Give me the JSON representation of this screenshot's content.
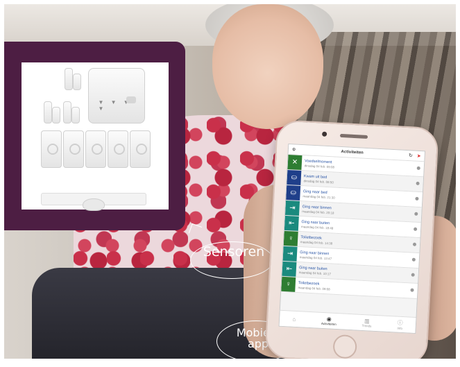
{
  "labels": {
    "sensors": "Sensoren",
    "app_line1": "Mobiele",
    "app_line2": "app"
  },
  "sensor_kit": {
    "hub_label": "▼ ▼ ▼ ▼"
  },
  "app": {
    "title": "Activiteiten",
    "icons": {
      "settings": "gear-icon",
      "refresh": "refresh-icon",
      "send": "paper-plane-icon"
    },
    "accent_green": "#2e7d32",
    "accent_blue": "#1f3f8a",
    "accent_teal": "#1b8a7e",
    "feed": [
      {
        "icon": "fork-knife-icon",
        "glyph": "✕",
        "color": "#2e7d32",
        "title": "Voedselmoment",
        "sub": "dinsdag 04 feb. 09:08"
      },
      {
        "icon": "bed-icon",
        "glyph": "⛀",
        "color": "#1f3f8a",
        "title": "Kwam uit bed",
        "sub": "dinsdag 04 feb. 08:50"
      },
      {
        "icon": "bed-icon",
        "glyph": "⛀",
        "color": "#1f3f8a",
        "title": "Ging naar bed",
        "sub": "maandag 04 feb. 21:30"
      },
      {
        "icon": "door-in-icon",
        "glyph": "⇥",
        "color": "#1b8a7e",
        "title": "Ging naar binnen",
        "sub": "maandag 04 feb. 20:18"
      },
      {
        "icon": "door-out-icon",
        "glyph": "⇤",
        "color": "#1b8a7e",
        "title": "Ging naar buiten",
        "sub": "maandag 04 feb. 18:48"
      },
      {
        "icon": "toilet-icon",
        "glyph": "♀",
        "color": "#2e7d32",
        "title": "Toiletbezoek",
        "sub": "maandag 04 feb. 14:38"
      },
      {
        "icon": "door-in-icon",
        "glyph": "⇥",
        "color": "#1b8a7e",
        "title": "Ging naar binnen",
        "sub": "maandag 04 feb. 13:47"
      },
      {
        "icon": "door-out-icon",
        "glyph": "⇤",
        "color": "#1b8a7e",
        "title": "Ging naar buiten",
        "sub": "maandag 04 feb. 10:17"
      },
      {
        "icon": "toilet-icon",
        "glyph": "♀",
        "color": "#2e7d32",
        "title": "Toiletbezoek",
        "sub": "maandag 04 feb. 09:08"
      }
    ],
    "tabs": [
      {
        "icon": "home-icon",
        "glyph": "⌂",
        "label": ""
      },
      {
        "icon": "activity-icon",
        "glyph": "◉",
        "label": "Activiteiten",
        "active": true
      },
      {
        "icon": "chart-icon",
        "glyph": "▥",
        "label": "Trends"
      },
      {
        "icon": "info-icon",
        "glyph": "ⓘ",
        "label": "Info"
      }
    ]
  }
}
